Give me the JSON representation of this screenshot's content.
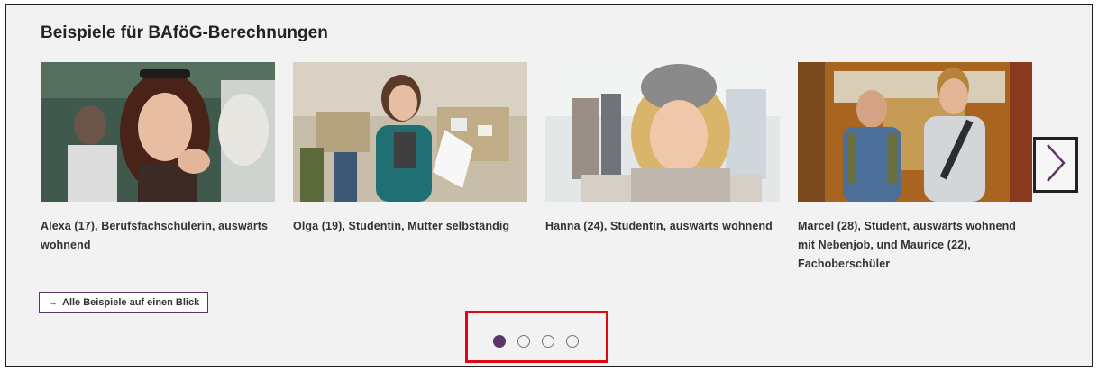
{
  "section": {
    "title": "Beispiele für BAföG-Berechnungen"
  },
  "carousel": {
    "cards": [
      {
        "caption": "Alexa (17), Berufsfachschülerin, auswärts wohnend"
      },
      {
        "caption": "Olga (19), Studentin, Mutter selbständig"
      },
      {
        "caption": "Hanna (24), Studentin, auswärts wohnend"
      },
      {
        "caption": "Marcel (28), Student, auswärts wohnend mit Nebenjob, und Maurice (22), Fachoberschüler"
      }
    ],
    "next_icon": "chevron-right-icon",
    "dots_total": 4,
    "dots_active_index": 0
  },
  "link": {
    "arrow": "→",
    "label": "Alle Beispiele auf einen Blick"
  },
  "colors": {
    "accent": "#5c3566",
    "highlight_border": "#e20613",
    "panel_bg": "#f2f2f2"
  }
}
